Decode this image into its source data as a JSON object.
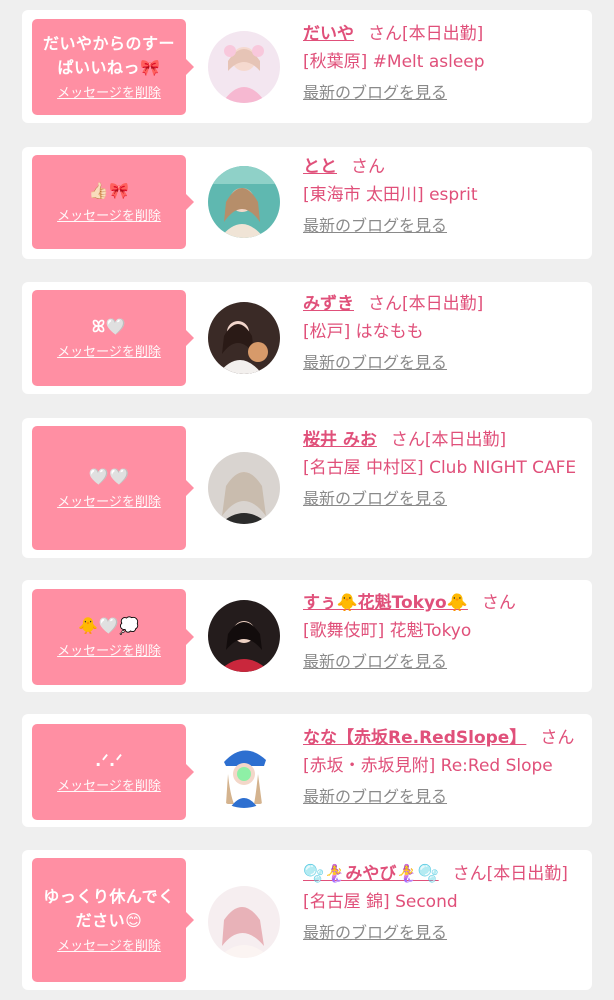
{
  "colors": {
    "page_bg": "#efefef",
    "card_bg": "#ffffff",
    "bubble_bg": "#ff8fa3",
    "name_color": "#e0507a",
    "link_gray": "#8a8a8a"
  },
  "delete_label": "メッセージを削除",
  "blog_label": "最新のブログを見る",
  "honorific": "さん",
  "messages": [
    {
      "bubble_text": "だいやからのすーぱいいねっ🎀",
      "name": "だいや",
      "status": "[本日出勤]",
      "shop": "[秋葉原] #Melt asleep",
      "avatar_icon": "avatar-photo"
    },
    {
      "bubble_text": "👍🏻🎀",
      "name": "とと",
      "status": "",
      "shop": "[東海市 太田川] esprit",
      "avatar_icon": "avatar-photo"
    },
    {
      "bubble_text": "ꕤ🤍",
      "name": "みずき",
      "status": "[本日出勤]",
      "shop": "[松戸] はなもも",
      "avatar_icon": "avatar-photo"
    },
    {
      "bubble_text": "🤍🤍",
      "name": "桜井 みお",
      "status": "[本日出勤]",
      "shop": "[名古屋 中村区] Club NIGHT CAFE",
      "avatar_icon": "avatar-photo"
    },
    {
      "bubble_text": "🐥🤍💭",
      "name": "すぅ🐥花魁Tokyo🐥",
      "status": "",
      "shop": "[歌舞伎町] 花魁Tokyo",
      "avatar_icon": "avatar-photo"
    },
    {
      "bubble_text": ".ᐟ.ᐟ",
      "name": "なな【赤坂Re.RedSlope】",
      "status": "",
      "shop": "[赤坂・赤坂見附] Re:Red Slope",
      "avatar_icon": "avatar-photo"
    },
    {
      "bubble_text": "ゆっくり休んでください😊",
      "name": "🫧🧜‍♀️みやび🧜‍♀️🫧",
      "status": "[本日出勤]",
      "shop": "[名古屋 錦] Second",
      "avatar_icon": "avatar-photo"
    }
  ]
}
